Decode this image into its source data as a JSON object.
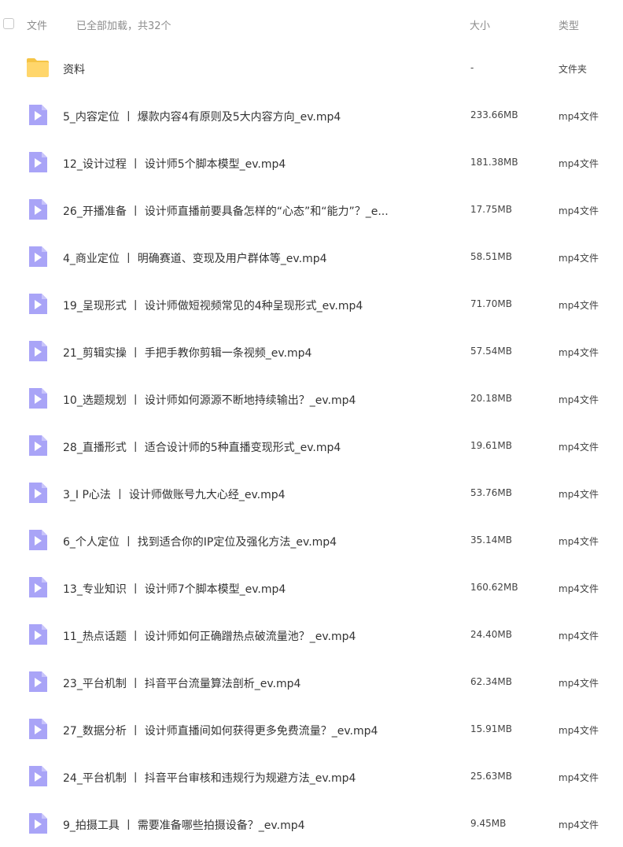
{
  "header": {
    "name_label": "文件",
    "loaded_status": "已全部加载，共32个",
    "size_label": "大小",
    "type_label": "类型"
  },
  "colors": {
    "folder": "#FFD66B",
    "video_icon": "#A9A4F7",
    "header_text": "#8C8C8C"
  },
  "rows": [
    {
      "icon": "folder-icon",
      "name": "资料",
      "size": "-",
      "type": "文件夹"
    },
    {
      "icon": "video-file-icon",
      "name": "5_内容定位 丨 爆款内容4有原则及5大内容方向_ev.mp4",
      "size": "233.66MB",
      "type": "mp4文件"
    },
    {
      "icon": "video-file-icon",
      "name": "12_设计过程 丨 设计师5个脚本模型_ev.mp4",
      "size": "181.38MB",
      "type": "mp4文件"
    },
    {
      "icon": "video-file-icon",
      "name": "26_开播准备 丨 设计师直播前要具备怎样的“心态”和“能力”？_e...",
      "size": "17.75MB",
      "type": "mp4文件"
    },
    {
      "icon": "video-file-icon",
      "name": "4_商业定位 丨 明确赛道、变现及用户群体等_ev.mp4",
      "size": "58.51MB",
      "type": "mp4文件"
    },
    {
      "icon": "video-file-icon",
      "name": "19_呈现形式 丨 设计师做短视频常见的4种呈现形式_ev.mp4",
      "size": "71.70MB",
      "type": "mp4文件"
    },
    {
      "icon": "video-file-icon",
      "name": "21_剪辑实操 丨 手把手教你剪辑一条视频_ev.mp4",
      "size": "57.54MB",
      "type": "mp4文件"
    },
    {
      "icon": "video-file-icon",
      "name": "10_选题规划 丨 设计师如何源源不断地持续输出？_ev.mp4",
      "size": "20.18MB",
      "type": "mp4文件"
    },
    {
      "icon": "video-file-icon",
      "name": "28_直播形式 丨 适合设计师的5种直播变现形式_ev.mp4",
      "size": "19.61MB",
      "type": "mp4文件"
    },
    {
      "icon": "video-file-icon",
      "name": "3_I P心法 丨 设计师做账号九大心经_ev.mp4",
      "size": "53.76MB",
      "type": "mp4文件"
    },
    {
      "icon": "video-file-icon",
      "name": "6_个人定位 丨 找到适合你的IP定位及强化方法_ev.mp4",
      "size": "35.14MB",
      "type": "mp4文件"
    },
    {
      "icon": "video-file-icon",
      "name": "13_专业知识 丨 设计师7个脚本模型_ev.mp4",
      "size": "160.62MB",
      "type": "mp4文件"
    },
    {
      "icon": "video-file-icon",
      "name": "11_热点话题 丨 设计师如何正确蹭热点破流量池？_ev.mp4",
      "size": "24.40MB",
      "type": "mp4文件"
    },
    {
      "icon": "video-file-icon",
      "name": "23_平台机制 丨 抖音平台流量算法剖析_ev.mp4",
      "size": "62.34MB",
      "type": "mp4文件"
    },
    {
      "icon": "video-file-icon",
      "name": "27_数据分析 丨 设计师直播间如何获得更多免费流量？_ev.mp4",
      "size": "15.91MB",
      "type": "mp4文件"
    },
    {
      "icon": "video-file-icon",
      "name": "24_平台机制 丨 抖音平台审核和违规行为规避方法_ev.mp4",
      "size": "25.63MB",
      "type": "mp4文件"
    },
    {
      "icon": "video-file-icon",
      "name": "9_拍摄工具 丨 需要准备哪些拍摄设备？_ev.mp4",
      "size": "9.45MB",
      "type": "mp4文件"
    }
  ]
}
